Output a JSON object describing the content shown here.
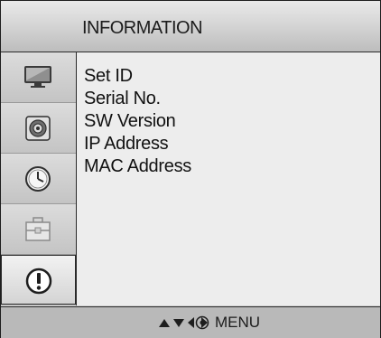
{
  "header": {
    "title": "INFORMATION"
  },
  "sidebar": {
    "items": [
      {
        "icon": "tv-screen-icon"
      },
      {
        "icon": "speaker-icon"
      },
      {
        "icon": "clock-icon"
      },
      {
        "icon": "toolbox-icon"
      },
      {
        "icon": "info-icon",
        "active": true
      }
    ]
  },
  "content": {
    "items": [
      {
        "label": "Set ID"
      },
      {
        "label": "Serial No."
      },
      {
        "label": "SW Version"
      },
      {
        "label": "IP Address"
      },
      {
        "label": "MAC Address"
      }
    ]
  },
  "footer": {
    "nav_icons": [
      "arrow-up-icon",
      "arrow-down-icon",
      "arrow-left-icon",
      "arrow-right-icon",
      "ok-button-icon"
    ],
    "menu_label": "MENU"
  }
}
